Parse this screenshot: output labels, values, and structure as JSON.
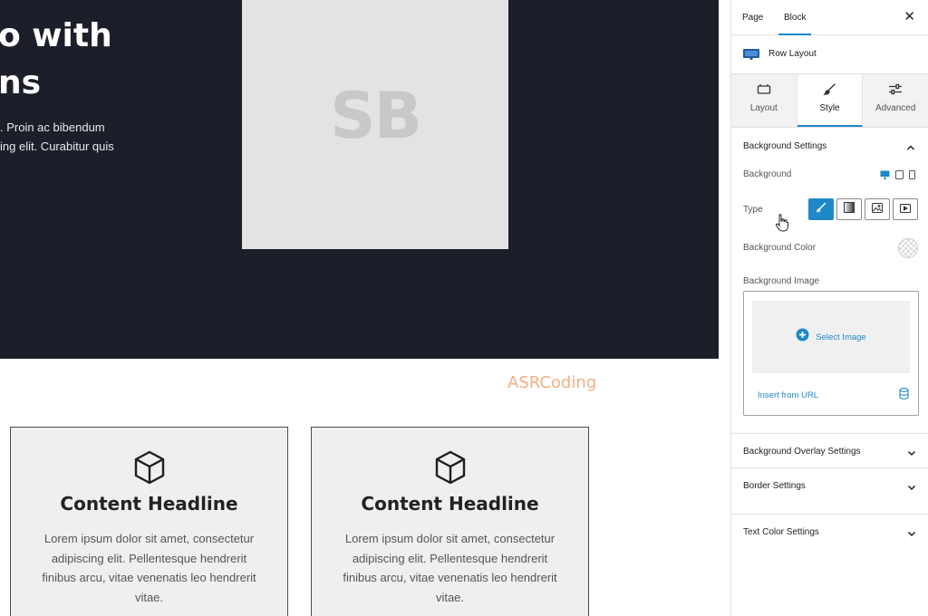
{
  "canvas": {
    "hero": {
      "title_line1": "o with",
      "title_line2": "ns",
      "text_line1": ". Proin ac bibendum",
      "text_line2": "ing elit. Curabitur quis",
      "image_logo": "SB"
    },
    "watermark": "ASRCoding",
    "cards": [
      {
        "icon": "cube-icon",
        "title": "Content Headline",
        "text": "Lorem ipsum dolor sit amet, consectetur adipiscing elit. Pellentesque hendrerit finibus arcu, vitae venenatis leo hendrerit vitae."
      },
      {
        "icon": "cube-icon",
        "title": "Content Headline",
        "text": "Lorem ipsum dolor sit amet, consectetur adipiscing elit. Pellentesque hendrerit finibus arcu, vitae venenatis leo hendrerit vitae."
      }
    ]
  },
  "sidebar": {
    "tabs": [
      "Page",
      "Block"
    ],
    "active_tab": "Block",
    "close_label": "✕",
    "block_name": "Row Layout",
    "style_tabs": [
      "Layout",
      "Style",
      "Advanced"
    ],
    "active_style_tab": "Style",
    "background_settings": {
      "title": "Background Settings",
      "background_label": "Background",
      "type_label": "Type",
      "type_options": [
        "color",
        "gradient",
        "image",
        "video"
      ],
      "active_type": "color",
      "color_label": "Background Color",
      "image_label": "Background Image",
      "select_image": "Select Image",
      "insert_from_url": "Insert from URL"
    },
    "collapsed_panels": {
      "overlay": "Background Overlay Settings",
      "border": "Border Settings",
      "text_color": "Text Color Settings"
    }
  },
  "colors": {
    "accent": "#1e88c8",
    "hero_bg": "#1c1f2a",
    "card_bg": "#efefef",
    "watermark": "#f0a070"
  }
}
